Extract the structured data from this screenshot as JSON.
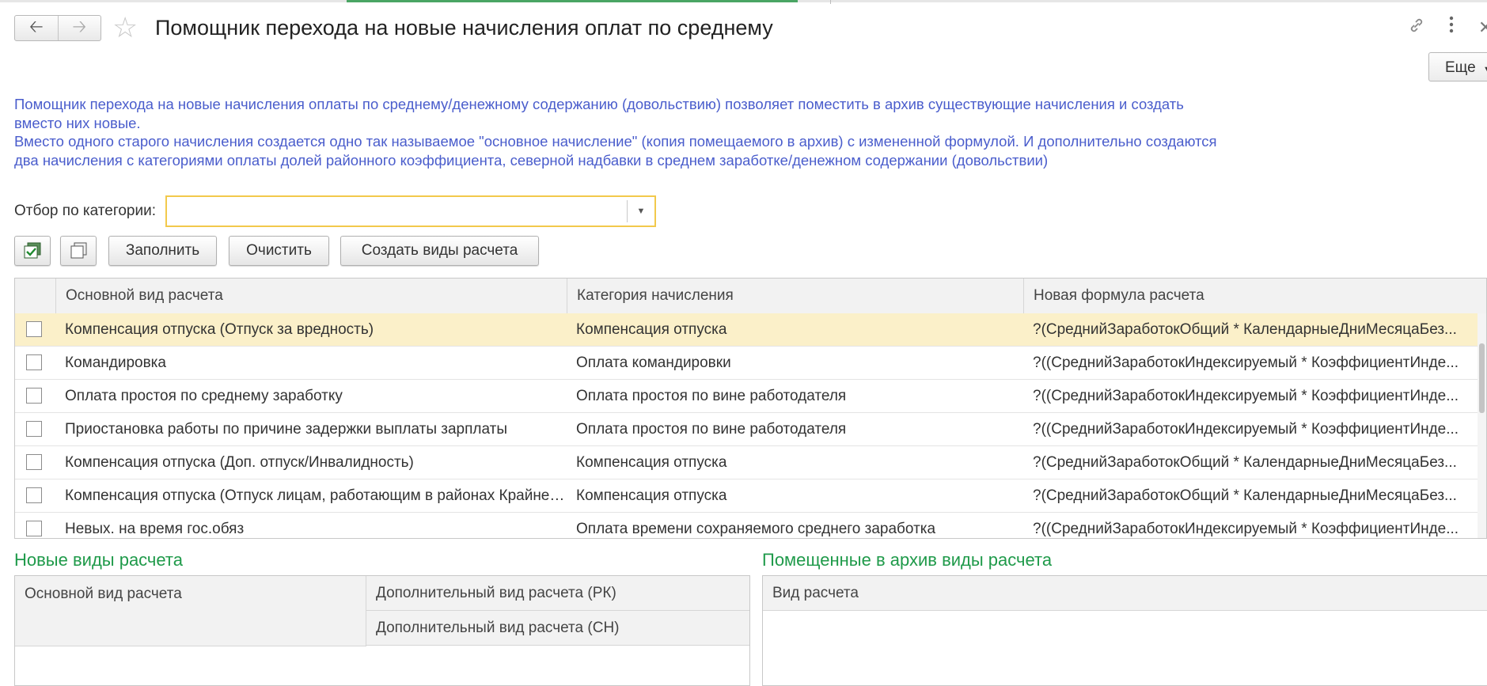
{
  "window": {
    "title": "Помощник перехода на новые начисления оплат по среднему",
    "more_label": "Еще"
  },
  "icons": {
    "back": "arrow-left-icon",
    "forward": "arrow-right-icon",
    "favorite": "star-icon",
    "link": "link-icon",
    "menu": "kebab-menu-icon",
    "close": "close-icon"
  },
  "info": {
    "para1": "Помощник перехода на новые начисления оплаты по среднему/денежному содержанию (довольствию) позволяет поместить в архив существующие начисления и создать вместо них новые.",
    "para2": "Вместо одного старого начисления создается одно так называемое \"основное начисление\" (копия помещаемого в архив) с измененной формулой. И дополнительно создаются два начисления с категориями оплаты долей районного коэффициента, северной надбавки в среднем заработке/денежном содержании (довольствии)"
  },
  "filter": {
    "label": "Отбор по категории:",
    "value": ""
  },
  "toolbar": {
    "fill_label": "Заполнить",
    "clear_label": "Очистить",
    "create_label": "Создать виды расчета"
  },
  "table": {
    "columns": [
      "Основной вид расчета",
      "Категория начисления",
      "Новая формула расчета"
    ],
    "rows": [
      {
        "name": "Компенсация отпуска (Отпуск за вредность)",
        "category": "Компенсация отпуска",
        "formula": "?(СреднийЗаработокОбщий * КалендарныеДниМесяцаБез..."
      },
      {
        "name": "Командировка",
        "category": "Оплата командировки",
        "formula": "?((СреднийЗаработокИндексируемый * КоэффициентИнде..."
      },
      {
        "name": "Оплата простоя по среднему заработку",
        "category": "Оплата простоя по вине работодателя",
        "formula": "?((СреднийЗаработокИндексируемый * КоэффициентИнде..."
      },
      {
        "name": "Приостановка работы по причине задержки выплаты зарплаты",
        "category": "Оплата простоя по вине работодателя",
        "formula": "?((СреднийЗаработокИндексируемый * КоэффициентИнде..."
      },
      {
        "name": "Компенсация отпуска (Доп. отпуск/Инвалидность)",
        "category": "Компенсация отпуска",
        "formula": "?(СреднийЗаработокОбщий * КалендарныеДниМесяцаБез..."
      },
      {
        "name": "Компенсация отпуска (Отпуск лицам, работающим в районах Крайнего Севера)",
        "category": "Компенсация отпуска",
        "formula": "?(СреднийЗаработокОбщий * КалендарныеДниМесяцаБез..."
      },
      {
        "name": "Невых. на время гос.обяз",
        "category": "Оплата времени сохраняемого среднего заработка",
        "formula": "?((СреднийЗаработокИндексируемый * КоэффициентИнде..."
      }
    ]
  },
  "new_types": {
    "title": "Новые виды расчета",
    "col_main": "Основной вид расчета",
    "col_rk": "Дополнительный вид расчета (РК)",
    "col_sn": "Дополнительный вид расчета (СН)"
  },
  "archived_types": {
    "title": "Помещенные в архив виды расчета",
    "col": "Вид расчета"
  },
  "colors": {
    "info_text": "#4a5dcc",
    "section_title": "#1f9a4a",
    "selected_row": "#fbf0c9",
    "filter_border": "#f2c94c"
  }
}
